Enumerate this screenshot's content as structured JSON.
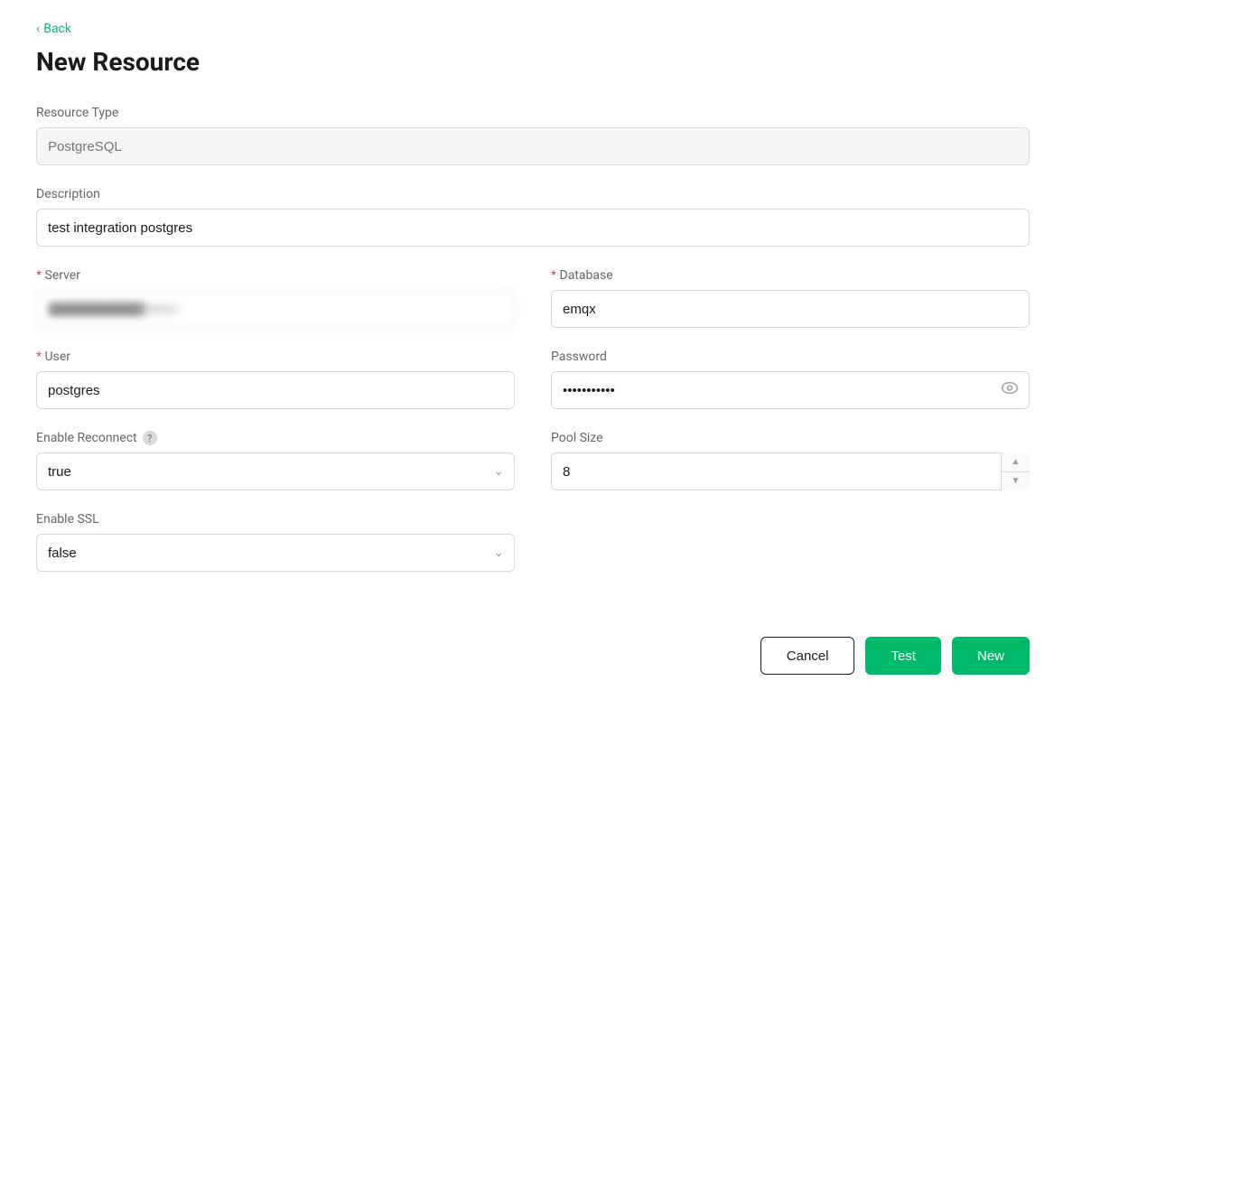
{
  "back": {
    "label": "Back"
  },
  "page": {
    "title": "New Resource"
  },
  "form": {
    "resource_type": {
      "label": "Resource Type",
      "placeholder": "PostgreSQL",
      "value": ""
    },
    "description": {
      "label": "Description",
      "value": "test integration postgres"
    },
    "server": {
      "label": "Server",
      "value": "██████████:5432",
      "blurred": true
    },
    "database": {
      "label": "Database",
      "value": "emqx"
    },
    "user": {
      "label": "User",
      "value": "postgres"
    },
    "password": {
      "label": "Password",
      "value": "••••••••"
    },
    "enable_reconnect": {
      "label": "Enable Reconnect",
      "value": "true",
      "options": [
        "true",
        "false"
      ]
    },
    "pool_size": {
      "label": "Pool Size",
      "value": "8"
    },
    "enable_ssl": {
      "label": "Enable SSL",
      "value": "false",
      "options": [
        "true",
        "false"
      ]
    }
  },
  "buttons": {
    "cancel": "Cancel",
    "test": "Test",
    "new": "New"
  }
}
